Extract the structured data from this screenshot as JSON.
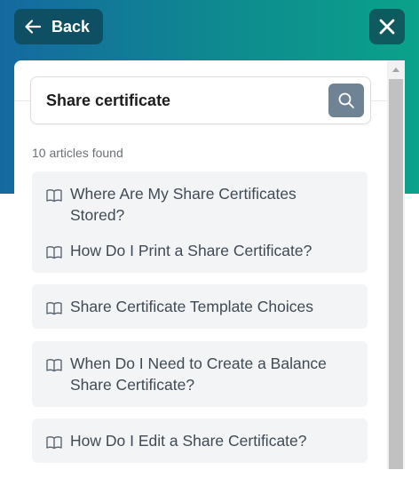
{
  "header": {
    "back_label": "Back",
    "accent_color": "#0e8b8f"
  },
  "search": {
    "value": "Share certificate"
  },
  "results": {
    "count_label": "10 articles found",
    "articles": [
      {
        "title": "Where Are My Share Certificates Stored?",
        "icon": "book-icon"
      },
      {
        "title": "How Do I Print a Share Certificate?",
        "icon": "book-icon"
      },
      {
        "title": "Share Certificate Template Choices",
        "icon": "book-icon"
      },
      {
        "title": "When Do I Need to Create a Balance Share Certificate?",
        "icon": "book-icon"
      },
      {
        "title": "How Do I Edit a Share Certificate?",
        "icon": "book-icon"
      }
    ]
  }
}
